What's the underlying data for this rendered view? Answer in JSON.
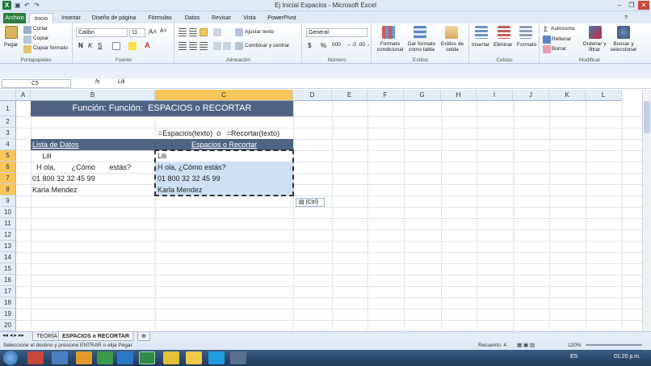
{
  "window": {
    "title": "Ej Inicial Espacios  -  Microsoft Excel"
  },
  "tabs": [
    "Archivo",
    "Inicio",
    "Insertar",
    "Diseño de página",
    "Fórmulas",
    "Datos",
    "Revisar",
    "Vista",
    "PowerPivot"
  ],
  "ribbon": {
    "clipboard": {
      "paste": "Pegar",
      "cut": "Cortar",
      "copy": "Copiar",
      "format_painter": "Copiar formato",
      "label": "Portapapeles"
    },
    "font": {
      "name": "Calibri",
      "size": "11",
      "bold": "N",
      "italic": "K",
      "underline": "S",
      "label": "Fuente"
    },
    "alignment": {
      "wrap": "Ajustar texto",
      "merge": "Combinar y centrar",
      "label": "Alineación"
    },
    "number": {
      "format": "General",
      "currency": "$",
      "percent": "%",
      "thousands": "000",
      "label": "Número"
    },
    "styles": {
      "conditional": "Formato condicional",
      "table": "Dar formato como tabla",
      "cell_styles": "Estilos de celda",
      "label": "Estilos"
    },
    "cells": {
      "insert": "Insertar",
      "delete": "Eliminar",
      "format": "Formato",
      "label": "Celdas"
    },
    "editing": {
      "autosum": "Autosuma",
      "fill": "Rellenar",
      "clear": "Borrar",
      "sort": "Ordenar y filtrar",
      "find": "Buscar y seleccionar",
      "label": "Modificar"
    }
  },
  "formula_bar": {
    "name_box": "C5",
    "fx": "fx",
    "value": "Lili"
  },
  "columns": [
    "A",
    "B",
    "C",
    "D",
    "E",
    "F",
    "G",
    "H",
    "I",
    "J",
    "K",
    "L"
  ],
  "rows": [
    "1",
    "2",
    "3",
    "4",
    "5",
    "6",
    "7",
    "8",
    "9",
    "10",
    "11",
    "12",
    "13",
    "14",
    "15",
    "16",
    "17",
    "18",
    "19",
    "20"
  ],
  "cells": {
    "title": "Función: Función:  ESPACIOS o RECORTAR",
    "formula_note": "=Espacios(texto)  o   =Recortar(texto)",
    "b_header": "Lista de Datos",
    "c_header": "Espacios o Recortar",
    "b5": "     Lili",
    "b6": "  H ola,        ¿Cómo       estás?",
    "b7": "01 800 32 32 45 99",
    "b8": "Karla Mendez",
    "c5": "Lili",
    "c6": "H ola, ¿Cómo estás?",
    "c7": "01 800 32 32 45 99",
    "c8": "Karla Mendez"
  },
  "paste_tag": "(Ctrl)",
  "sheets": [
    "TEORÍA",
    "ESPACIOS o RECORTAR"
  ],
  "status": {
    "message": "Seleccione el destino y presione ENTRAR o elija Pegar",
    "count": "Recuento: 4",
    "zoom": "120%"
  },
  "taskbar": {
    "lang": "ES",
    "time": "01:20 p.m."
  }
}
